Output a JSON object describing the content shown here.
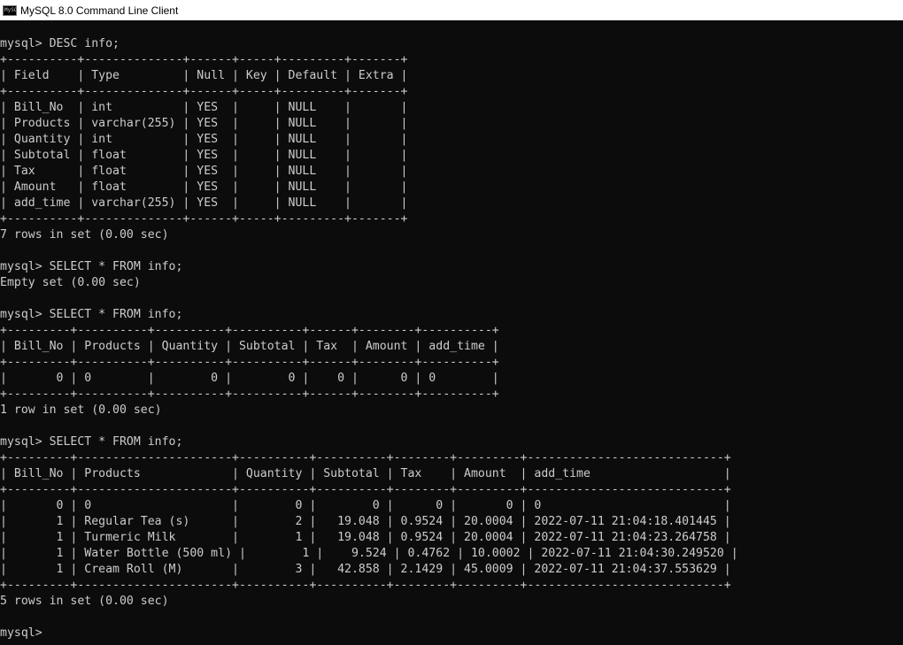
{
  "window": {
    "title": "MySQL 8.0 Command Line Client",
    "icon": "console-app-icon",
    "icon_text": "MySQL"
  },
  "console": {
    "colors": {
      "background": "#0c0c0c",
      "text": "#cccccc"
    },
    "lines": [
      "",
      "mysql> DESC info;",
      "+----------+--------------+------+-----+---------+-------+",
      "| Field    | Type         | Null | Key | Default | Extra |",
      "+----------+--------------+------+-----+---------+-------+",
      "| Bill_No  | int          | YES  |     | NULL    |       |",
      "| Products | varchar(255) | YES  |     | NULL    |       |",
      "| Quantity | int          | YES  |     | NULL    |       |",
      "| Subtotal | float        | YES  |     | NULL    |       |",
      "| Tax      | float        | YES  |     | NULL    |       |",
      "| Amount   | float        | YES  |     | NULL    |       |",
      "| add_time | varchar(255) | YES  |     | NULL    |       |",
      "+----------+--------------+------+-----+---------+-------+",
      "7 rows in set (0.00 sec)",
      "",
      "mysql> SELECT * FROM info;",
      "Empty set (0.00 sec)",
      "",
      "mysql> SELECT * FROM info;",
      "+---------+----------+----------+----------+------+--------+----------+",
      "| Bill_No | Products | Quantity | Subtotal | Tax  | Amount | add_time |",
      "+---------+----------+----------+----------+------+--------+----------+",
      "|       0 | 0        |        0 |        0 |    0 |      0 | 0        |",
      "+---------+----------+----------+----------+------+--------+----------+",
      "1 row in set (0.00 sec)",
      "",
      "mysql> SELECT * FROM info;",
      "+---------+----------------------+----------+----------+--------+---------+----------------------------+",
      "| Bill_No | Products             | Quantity | Subtotal | Tax    | Amount  | add_time                   |",
      "+---------+----------------------+----------+----------+--------+---------+----------------------------+",
      "|       0 | 0                    |        0 |        0 |      0 |       0 | 0                          |",
      "|       1 | Regular Tea (s)      |        2 |   19.048 | 0.9524 | 20.0004 | 2022-07-11 21:04:18.401445 |",
      "|       1 | Turmeric Milk        |        1 |   19.048 | 0.9524 | 20.0004 | 2022-07-11 21:04:23.264758 |",
      "|       1 | Water Bottle (500 ml) |        1 |    9.524 | 0.4762 | 10.0002 | 2022-07-11 21:04:30.249520 |",
      "|       1 | Cream Roll (M)       |        3 |   42.858 | 2.1429 | 45.0009 | 2022-07-11 21:04:37.553629 |",
      "+---------+----------------------+----------+----------+--------+---------+----------------------------+",
      "5 rows in set (0.00 sec)",
      "",
      "mysql> "
    ]
  }
}
